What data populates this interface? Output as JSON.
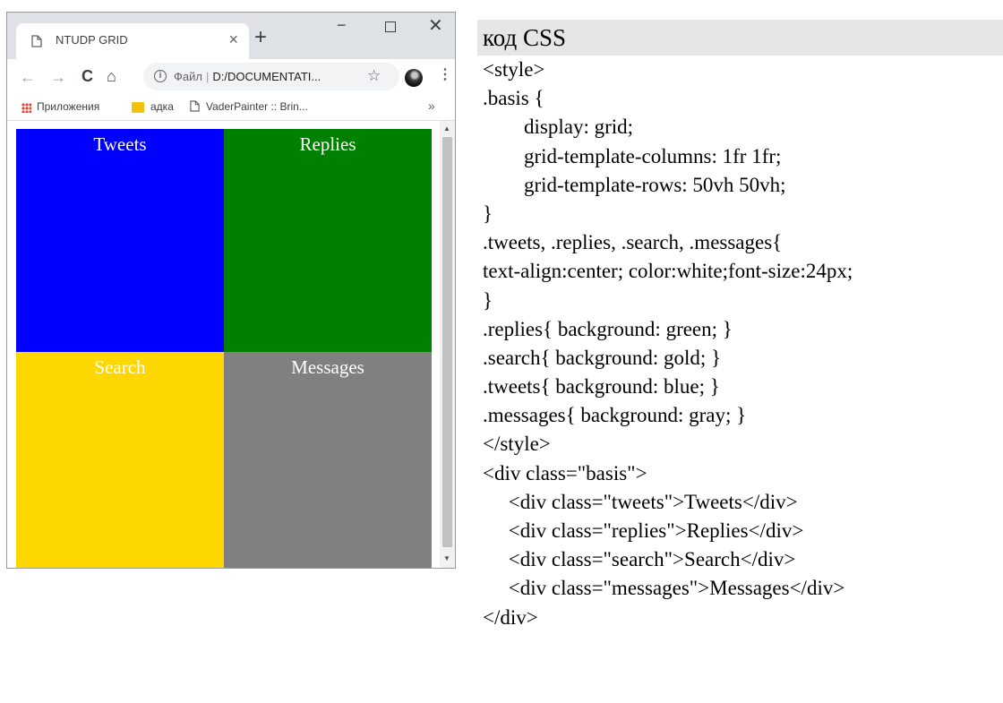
{
  "browser": {
    "tab_title": "NTUDP GRID",
    "tab_close": "×",
    "new_tab": "+",
    "window": {
      "minimize": "−",
      "close": "✕"
    },
    "nav": {
      "back": "←",
      "forward": "→",
      "reload": "C",
      "home": "⌂"
    },
    "address": {
      "label": "Файл",
      "separator": "|",
      "url": "D:/DOCUMENTATI..."
    },
    "star": "☆",
    "menu": "⋮",
    "bookmarks": {
      "apps": "Приложения",
      "folder": "адка",
      "page": "VaderPainter :: Brin...",
      "more": "»"
    },
    "grid": [
      {
        "label": "Tweets",
        "color": "#0000ff"
      },
      {
        "label": "Replies",
        "color": "#008000"
      },
      {
        "label": "Search",
        "color": "#ffd700"
      },
      {
        "label": "Messages",
        "color": "#808080"
      }
    ]
  },
  "code": {
    "header": "код CSS",
    "lines": [
      "<style>",
      ".basis {",
      "        display: grid;",
      "        grid-template-columns: 1fr 1fr;",
      "        grid-template-rows: 50vh 50vh;",
      "}",
      ".tweets, .replies, .search, .messages{",
      "text-align:center; color:white;font-size:24px;",
      "}",
      ".replies{ background: green; }",
      ".search{ background: gold; }",
      ".tweets{ background: blue; }",
      ".messages{ background: gray; }",
      "</style>",
      "<div class=\"basis\">",
      "     <div class=\"tweets\">Tweets</div>",
      "     <div class=\"replies\">Replies</div>",
      "     <div class=\"search\">Search</div>",
      "     <div class=\"messages\">Messages</div>",
      "</div>"
    ]
  }
}
